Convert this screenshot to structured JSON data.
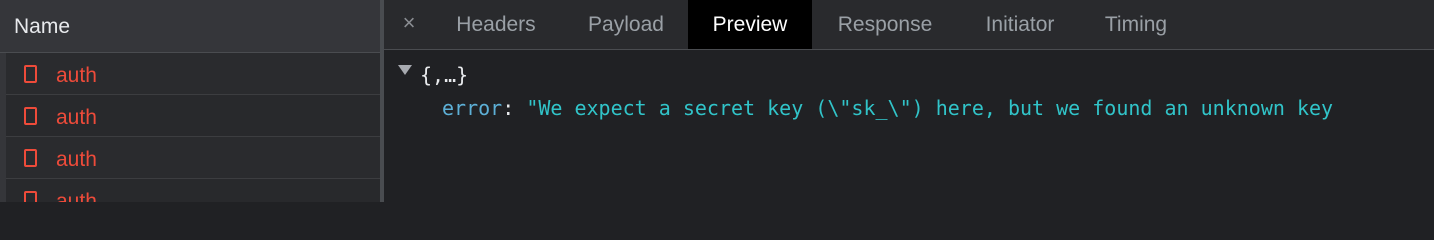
{
  "left_panel": {
    "header_label": "Name",
    "requests": [
      {
        "name": "auth"
      },
      {
        "name": "auth"
      },
      {
        "name": "auth"
      },
      {
        "name": "auth"
      }
    ],
    "error_color": "#ee4b3a"
  },
  "tabs": {
    "close_glyph": "×",
    "items": [
      {
        "label": "Headers"
      },
      {
        "label": "Payload"
      },
      {
        "label": "Preview"
      },
      {
        "label": "Response"
      },
      {
        "label": "Initiator"
      },
      {
        "label": "Timing"
      }
    ],
    "active": "Preview"
  },
  "preview": {
    "root_summary": "{,…}",
    "property": {
      "key": "error",
      "separator": ": ",
      "value": "\"We expect a secret key (\\\"sk_\\\") here, but we found an unknown key"
    }
  }
}
